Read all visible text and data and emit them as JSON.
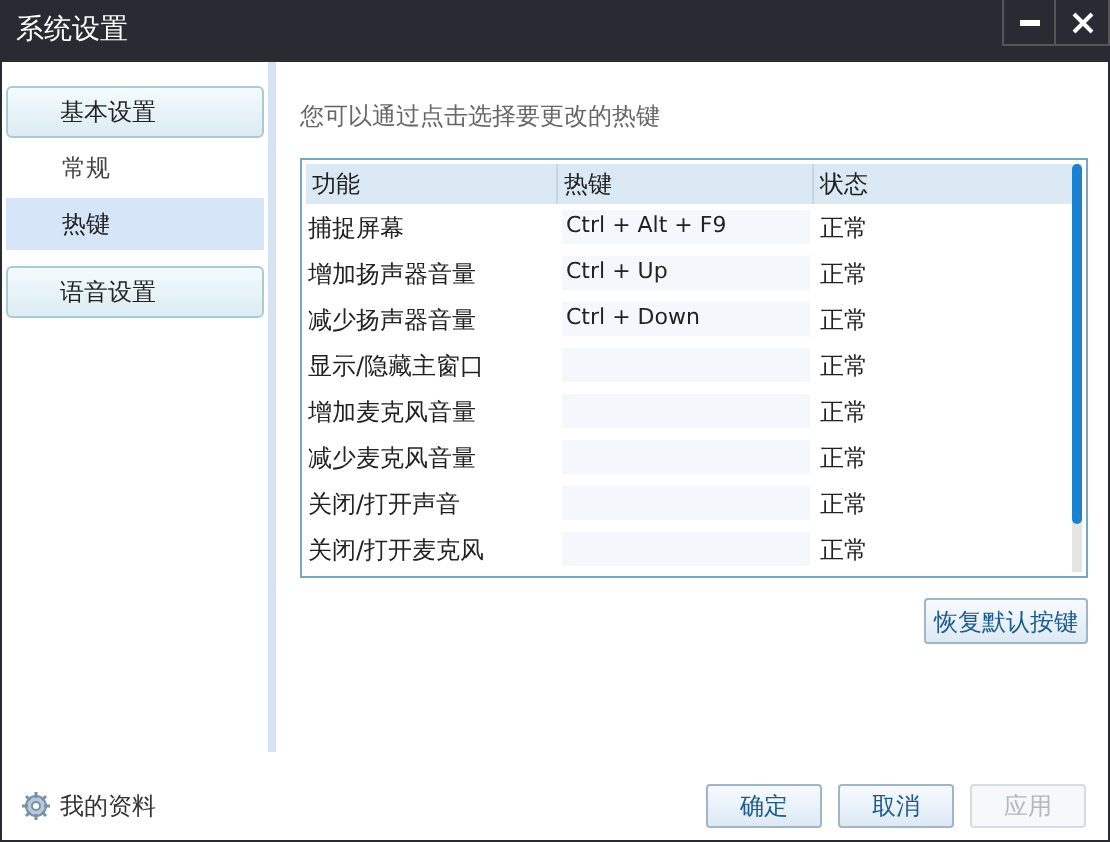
{
  "window": {
    "title": "系统设置"
  },
  "sidebar": {
    "sections": [
      {
        "title": "基本设置",
        "items": [
          {
            "label": "常规",
            "selected": false
          },
          {
            "label": "热键",
            "selected": true
          }
        ]
      },
      {
        "title": "语音设置"
      }
    ],
    "profile_link": "我的资料"
  },
  "hint": "您可以通过点击选择要更改的热键",
  "table": {
    "columns": [
      "功能",
      "热键",
      "状态"
    ],
    "rows": [
      {
        "function": "捕捉屏幕",
        "hotkey": "Ctrl + Alt + F9",
        "status": "正常"
      },
      {
        "function": "增加扬声器音量",
        "hotkey": "Ctrl + Up",
        "status": "正常"
      },
      {
        "function": "减少扬声器音量",
        "hotkey": "Ctrl + Down",
        "status": "正常"
      },
      {
        "function": "显示/隐藏主窗口",
        "status": "正常"
      },
      {
        "function": "增加麦克风音量",
        "status": "正常"
      },
      {
        "function": "减少麦克风音量",
        "status": "正常"
      },
      {
        "function": "关闭/打开声音",
        "status": "正常"
      },
      {
        "function": "关闭/打开麦克风",
        "status": "正常"
      }
    ]
  },
  "restore_button": "恢复默认按键",
  "buttons": [
    {
      "label": "确定",
      "disabled": false
    },
    {
      "label": "取消",
      "disabled": false
    },
    {
      "label": "应用",
      "disabled": true
    }
  ]
}
